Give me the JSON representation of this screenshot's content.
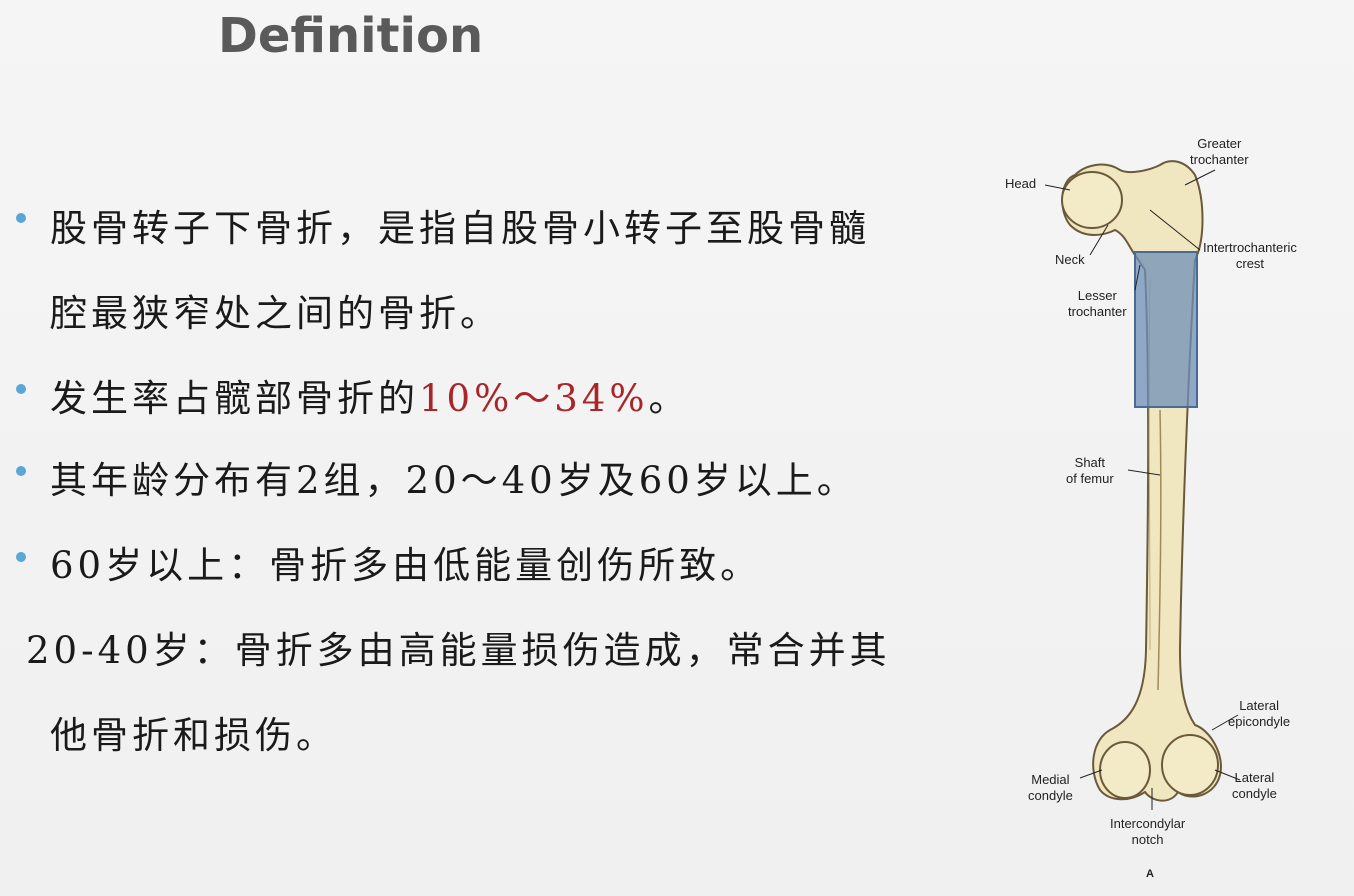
{
  "title": "Definition",
  "bullets": {
    "b1_line1": "股骨转子下骨折，是指自股骨小转子至股骨髓",
    "b1_line2": "腔最狭窄处之间的骨折。",
    "b2_prefix": "发生率占髋部骨折的",
    "b2_highlight": "10%～34%",
    "b2_suffix": "。",
    "b3": "其年龄分布有2组，20～40岁及60岁以上。",
    "b4": "60岁以上：骨折多由低能量创伤所致。",
    "b5_line1": "20-40岁：骨折多由高能量损伤造成，常合并其",
    "b5_line2": "他骨折和损伤。"
  },
  "femur_labels": {
    "head": "Head",
    "greater_trochanter": "Greater\ntrochanter",
    "neck": "Neck",
    "intertrochanteric_crest": "Intertrochanteric\ncrest",
    "lesser_trochanter": "Lesser\ntrochanter",
    "shaft": "Shaft\nof femur",
    "lateral_epicondyle": "Lateral\nepicondyle",
    "medial_condyle": "Medial\ncondyle",
    "lateral_condyle": "Lateral\ncondyle",
    "intercondylar_notch": "Intercondylar\nnotch",
    "figure_letter": "A"
  },
  "colors": {
    "bullet": "#5aa6d6",
    "highlight": "#a8262a",
    "title": "#5a5a5a",
    "bone": "#f0e6c0",
    "overlay": "#6f8fb8"
  }
}
